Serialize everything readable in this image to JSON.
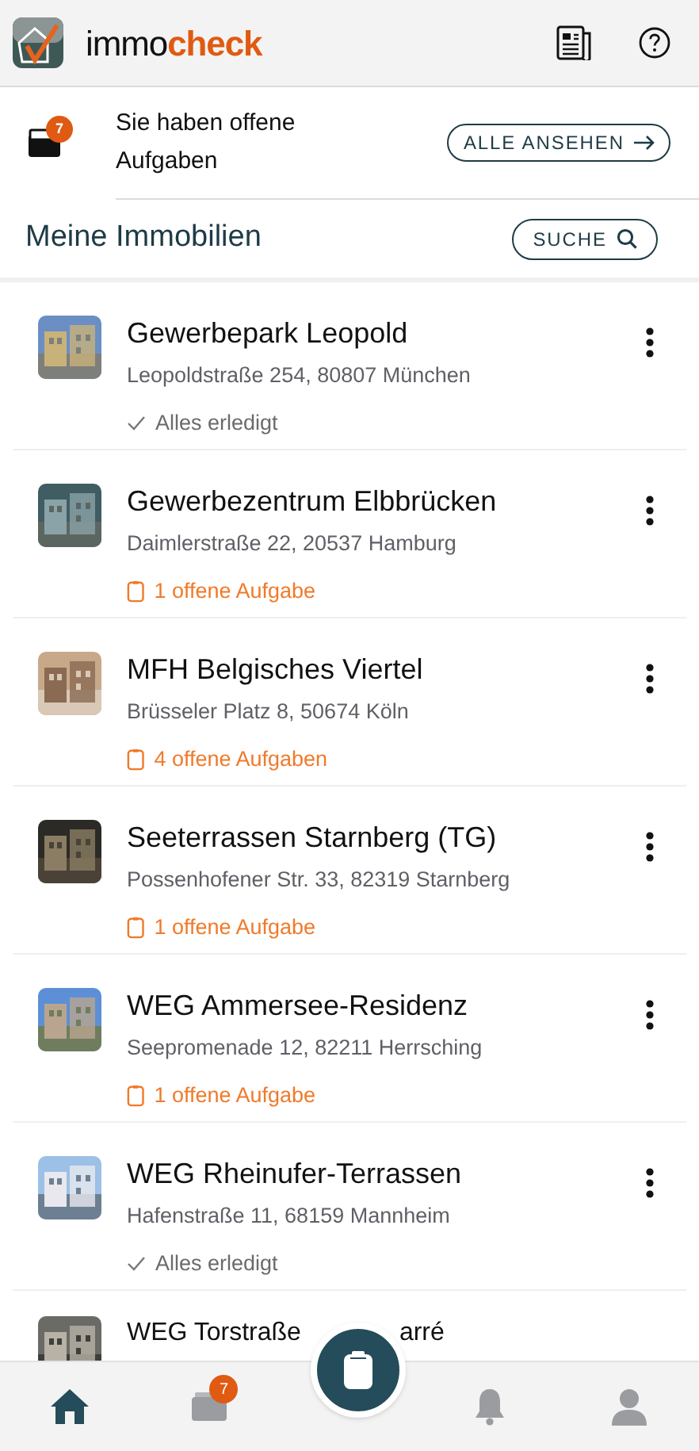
{
  "app": {
    "name_part_1": "immo",
    "name_part_2": "check"
  },
  "tasks_banner": {
    "badge": "7",
    "text": "Sie haben offene Aufgaben",
    "button": "ALLE ANSEHEN"
  },
  "section": {
    "title": "Meine Immobilien",
    "button": "SUCHE"
  },
  "properties": [
    {
      "title": "Gewerbepark Leopold",
      "address": "Leopoldstraße 254, 80807 München",
      "status": "Alles erledigt",
      "kind": "done"
    },
    {
      "title": "Gewerbezentrum Elbbrücken",
      "address": "Daimlerstraße 22, 20537 Hamburg",
      "status": "1 offene Aufgabe",
      "kind": "open"
    },
    {
      "title": "MFH Belgisches Viertel",
      "address": "Brüsseler Platz 8, 50674 Köln",
      "status": "4 offene Aufgaben",
      "kind": "open"
    },
    {
      "title": "Seeterrassen Starnberg (TG)",
      "address": "Possenhofener Str. 33, 82319 Starnberg",
      "status": "1 offene Aufgabe",
      "kind": "open"
    },
    {
      "title": "WEG Ammersee-Residenz",
      "address": "Seepromenade 12, 82211 Herrsching",
      "status": "1 offene Aufgabe",
      "kind": "open"
    },
    {
      "title": "WEG Rheinufer-Terrassen",
      "address": "Hafenstraße 11, 68159 Mannheim",
      "status": "Alles erledigt",
      "kind": "done"
    }
  ],
  "partial_property": {
    "title_parts": [
      "WEG Torstraße",
      "arré"
    ]
  },
  "bottom_nav": [
    {
      "kind": "home",
      "selected": true
    },
    {
      "kind": "tasks",
      "selected": false,
      "badge": "7"
    },
    {
      "kind": "bell",
      "selected": false
    },
    {
      "kind": "user",
      "selected": false
    }
  ]
}
